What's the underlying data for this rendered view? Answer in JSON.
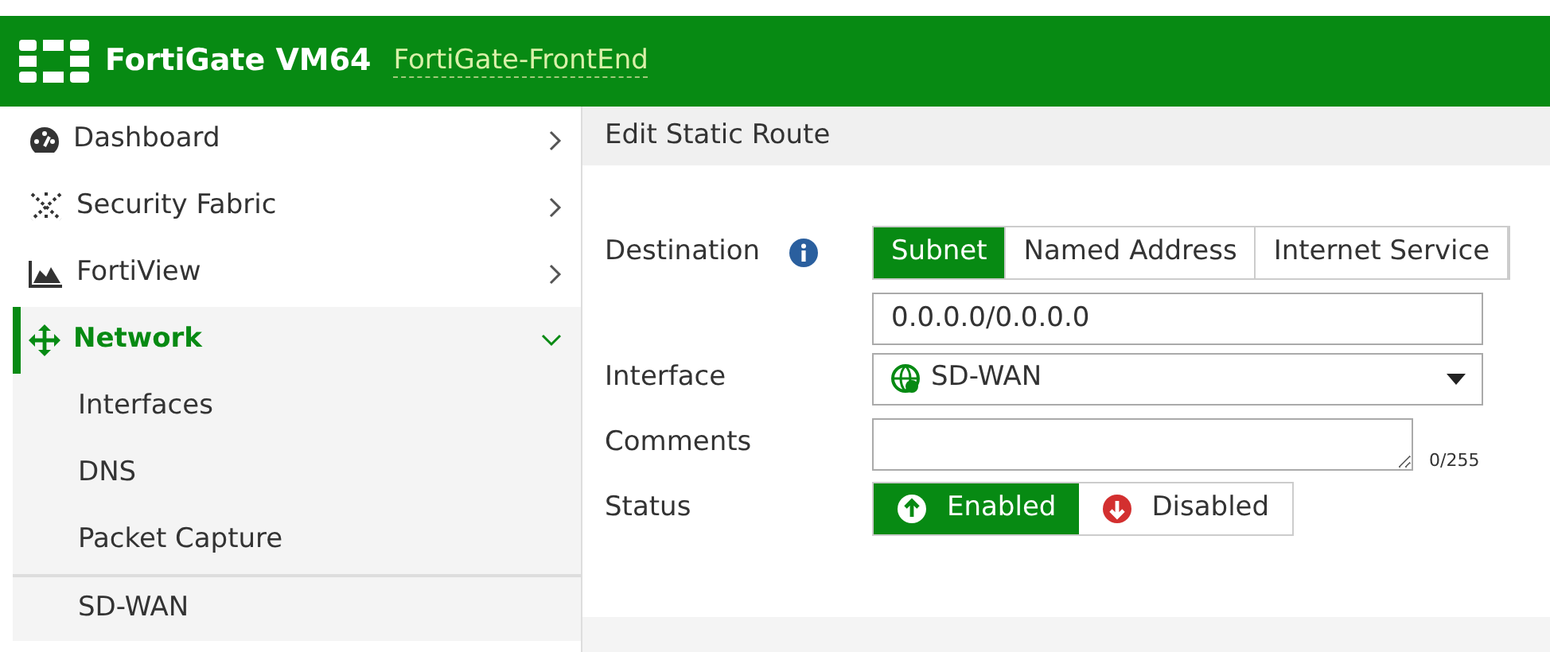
{
  "header": {
    "product": "FortiGate VM64",
    "hostname": "FortiGate-FrontEnd"
  },
  "sidebar": {
    "items": [
      {
        "label": "Dashboard",
        "kind": "dashboard",
        "expanded": false,
        "selected": false
      },
      {
        "label": "Security Fabric",
        "kind": "fabric",
        "expanded": false,
        "selected": false
      },
      {
        "label": "FortiView",
        "kind": "chart",
        "expanded": false,
        "selected": false
      },
      {
        "label": "Network",
        "kind": "network",
        "expanded": true,
        "selected": true,
        "children": [
          {
            "label": "Interfaces"
          },
          {
            "label": "DNS"
          },
          {
            "label": "Packet Capture"
          },
          {
            "label": "SD-WAN"
          }
        ]
      }
    ]
  },
  "panel": {
    "title": "Edit Static Route",
    "destination": {
      "label": "Destination",
      "options": [
        {
          "label": "Subnet",
          "selected": true
        },
        {
          "label": "Named Address",
          "selected": false
        },
        {
          "label": "Internet Service",
          "selected": false
        }
      ],
      "value": "0.0.0.0/0.0.0.0"
    },
    "interface": {
      "label": "Interface",
      "value": "SD-WAN"
    },
    "comments": {
      "label": "Comments",
      "counter": "0/255"
    },
    "status": {
      "label": "Status",
      "options": [
        {
          "label": "Enabled",
          "kind": "up",
          "selected": true
        },
        {
          "label": "Disabled",
          "kind": "down",
          "selected": false
        }
      ]
    }
  }
}
